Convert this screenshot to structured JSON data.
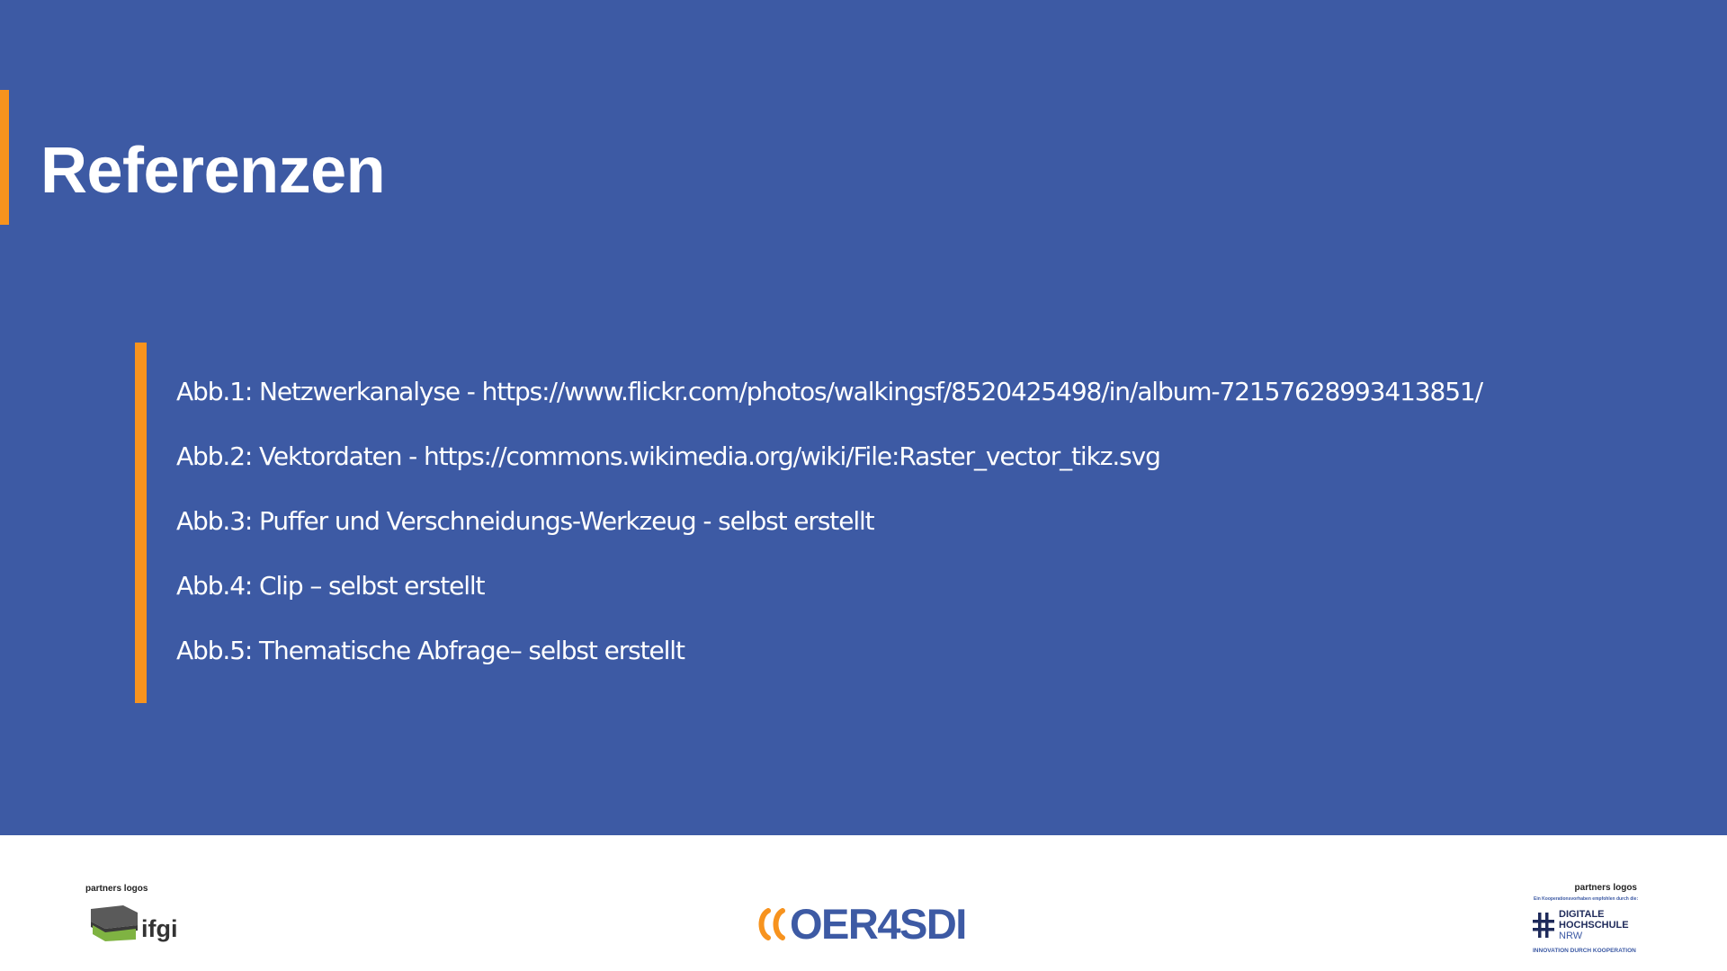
{
  "slide": {
    "title": "Referenzen",
    "references": [
      "Abb.1: Netzwerkanalyse - https://www.flickr.com/photos/walkingsf/8520425498/in/album-72157628993413851/",
      "Abb.2: Vektordaten - https://commons.wikimedia.org/wiki/File:Raster_vector_tikz.svg",
      "Abb.3: Puffer und Verschneidungs-Werkzeug - selbst erstellt",
      "Abb.4: Clip – selbst erstellt",
      "Abb.5: Thematische Abfrage– selbst erstellt"
    ]
  },
  "footer": {
    "left_logo": {
      "label": "partners logos",
      "name": "ifgi",
      "icon": "ifgi-logo-icon"
    },
    "center_logo": {
      "name": "OER4SDI",
      "icon": "chevrons-icon"
    },
    "right_logo": {
      "label": "partners logos",
      "subtitle": "Ein Kooperationsvorhaben empfohlen durch die:",
      "line1": "DIGITALE",
      "line2": "HOCHSCHULE",
      "line3": "NRW",
      "tagline": "INNOVATION DURCH KOOPERATION",
      "icon": "hashtag-icon"
    }
  },
  "colors": {
    "background_blue": "#3d5aa4",
    "accent_orange": "#f7931e",
    "text_white": "#ffffff",
    "footer_bg": "#ffffff"
  }
}
